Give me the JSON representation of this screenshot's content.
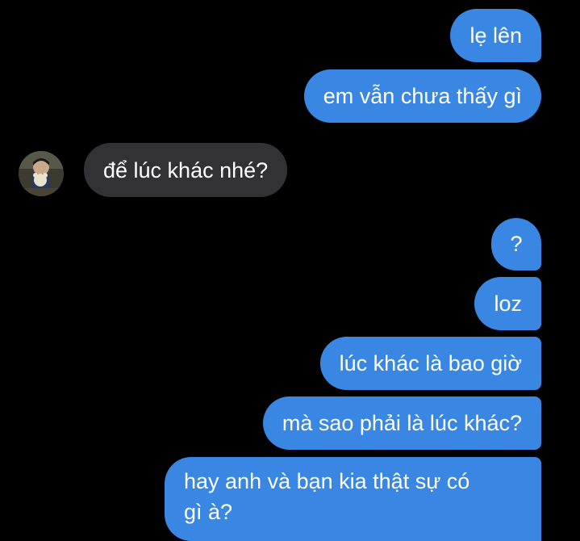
{
  "conversation": {
    "messages": [
      {
        "direction": "outgoing",
        "text": "lẹ lên"
      },
      {
        "direction": "outgoing",
        "text": "em vẫn chưa thấy gì"
      },
      {
        "direction": "incoming",
        "text": "để lúc khác nhé?"
      },
      {
        "direction": "outgoing",
        "text": "?"
      },
      {
        "direction": "outgoing",
        "text": "loz"
      },
      {
        "direction": "outgoing",
        "text": "lúc khác là bao giờ"
      },
      {
        "direction": "outgoing",
        "text": "mà sao phải là lúc khác?"
      },
      {
        "direction": "outgoing",
        "text": "hay anh và bạn kia thật sự có\ngì à?"
      }
    ]
  },
  "colors": {
    "background": "#000000",
    "outgoing_bubble": "#3a87e3",
    "incoming_bubble": "#323234",
    "text": "#ffffff"
  },
  "avatar": {
    "icon": "contact-avatar-photo"
  }
}
